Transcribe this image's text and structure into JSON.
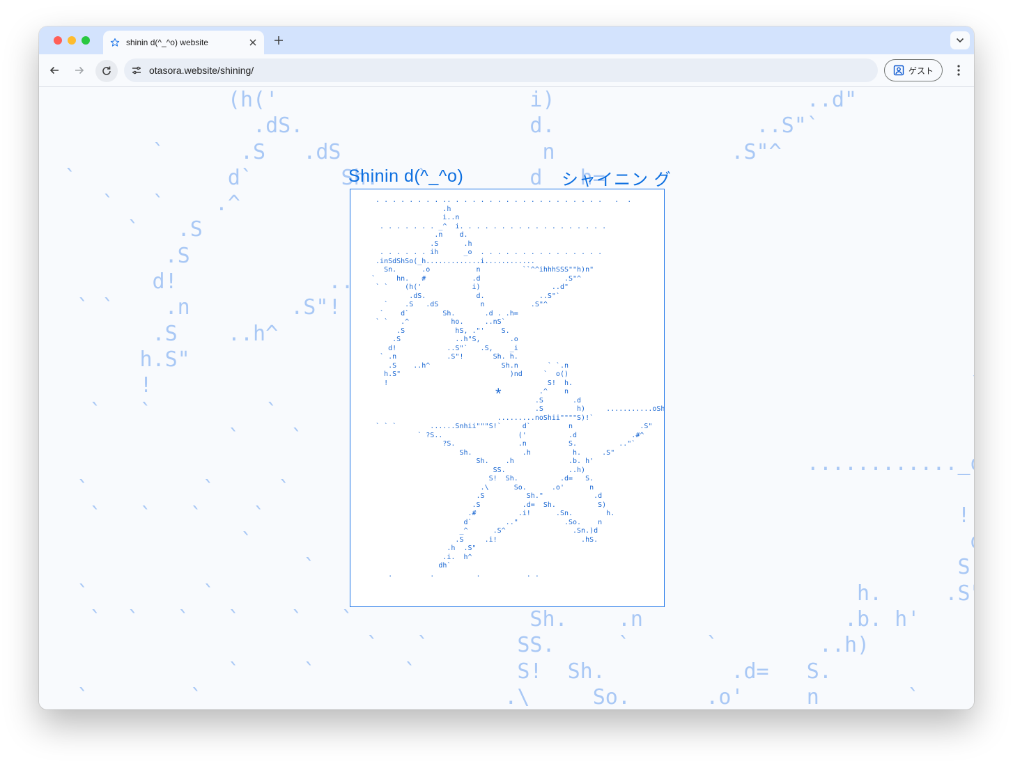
{
  "browser": {
    "tab_title": "shinin d(^_^o) website",
    "url": "otasora.website/shining/",
    "guest_label": "ゲスト",
    "icons": [
      "star-icon",
      "close-icon",
      "plus-icon",
      "chevron-down-icon",
      "arrow-left-icon",
      "arrow-right-icon",
      "reload-icon",
      "site-settings-icon",
      "person-icon",
      "kebab-menu-icon"
    ]
  },
  "page": {
    "title": "Shinin d(^_^o)",
    "title_jp": "シャイニン グ",
    "star_glyph": "*",
    "art": "  . . . . . . . . .. . . . . . . . . . . . . . . . . . .   .  .\n                  .h\n                  i..n\n   . . . . . . . _^  i. . . . . . . . . . . . . . . . . .\n                .n    d.\n               .S      .h\n   . . . . . . ih      _o  . . . . . . . . . . . . . . .\n  .inSdShSo(_h.............i............\n    Sn.      .o           n          ``^^ihhhSSS\"\"h)n\"\n `     hn.   #           .d                    .S\"^\n  ` `    (h('            i)                 ..d\"\n          .dS.            d.             ..S\"`\n    `    .S   .dS          n           .S\"^\n   `    d`        Sh.       .d . .h=\n  ` `   .^          ho.     ..nS`\n       .S            hS, .\"'    S.\n      .S             ..h\"S,       .o\n     d!            ..S\"`   .S,    _i\n   ` .n            .S\"!       Sh. h.\n     .S    ..h^                 Sh.n       ` `.n\n    h.S\"                          )nd     `  o()\n    !                                      S!  h.\n                                         .^    n\n                                        .S       .d\n                                        .S        h)     ...........oShi\"\"\"\")i#^\n                               .........noShii\"\"\"\"S)!`                   ..h`\n  ` ` `        ......Snhii\"\"\"S!`     d`         n                .S\"\n            ` ?S..                  ('          .d             .#^\n                  ?S.               .n          S.          ..\"`\n                      Sh.            .h          h.     .S\"\n                          Sh.    .h             .b. h'\n                              SS.               ..h)\n                             S!  Sh.          .d=   S.\n                           .\\      So.      .o'      n\n                          .S          Sh.\"            .d\n                         .S          .d=  Sh.          S)\n                        .#          .i!      .Sn.        h.\n                       d`        ..\"           .So.    n\n                      _^      .S^                .Sn.)d\n                     .S     .i!                    .hS.\n                   .h  .S\"\n                  .i.  h^\n                 dh`\n     .         .          .           . .",
    "bg_art": "               (h('                    i)                    ..d\"\n                 .dS.                  d.                ..S\"`\n         `      .S   .dS                n              .S\"^                        `       `       `\n  `            d`       Sh.   `        d   h=                                         `      `       `\n     `   `    .^          ho.         ..nS`                                    `\n       `   .S              hS                                                           `       `\n          .S               ..h                                                `      `\n         d!            ..S\"`                                                         `       `\n   ` `    .n        .S\"!                                                          `      `       `\n         .S    ..h^                                                                         `\n        h.S\"                                                                                `\n        !                                                                 `       `      `\n    `   `         `                                                        `          `\n               `    `                                                             ..\n                                                             ............_oShi\"\"\"\")i#^   `\n   `         `     `                                                           ..h`\n    `   `   `    `         ......S                                       !         .S\"\n                `         ` ?S..                                          d      .#^  `   `\n                     `           ?S                                      S.     ..\"`\n   `         `                                                   h.     .S\"\n    `  `   `   `    `   `              Sh.    .n                .b. h'      `    `\n                          `   `       SS.     `      `        ..h)            `\n               `     `       `        S!  Sh.          .d=   S.\n   `        `                        .\\     So.      .o'     n       `      `\n                                                                              `    `"
  }
}
